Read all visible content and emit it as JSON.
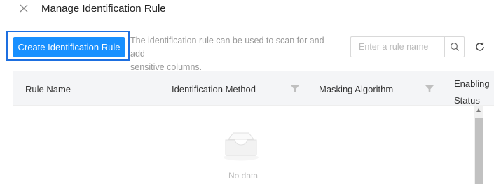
{
  "dialog": {
    "title": "Manage Identification Rule",
    "close_icon": "close-icon"
  },
  "toolbar": {
    "create_label": "Create Identification Rule",
    "description_line1": "The identification rule can be used to scan for and add",
    "description_line2": "sensitive columns.",
    "search_placeholder": "Enter a rule name",
    "search_icon": "search-icon",
    "refresh_icon": "refresh-icon"
  },
  "table": {
    "columns": [
      {
        "label": "Rule Name",
        "filterable": false
      },
      {
        "label": "Identification Method",
        "filterable": true
      },
      {
        "label": "Masking Algorithm",
        "filterable": true
      },
      {
        "label_line1": "Enabling",
        "label_line2": "Status",
        "filterable": false
      }
    ],
    "rows": [],
    "empty_text": "No data",
    "empty_icon": "empty-inbox-icon"
  },
  "colors": {
    "primary": "#1890ff",
    "highlight_border": "#1d6fe0",
    "header_bg": "#f4f5f7"
  }
}
